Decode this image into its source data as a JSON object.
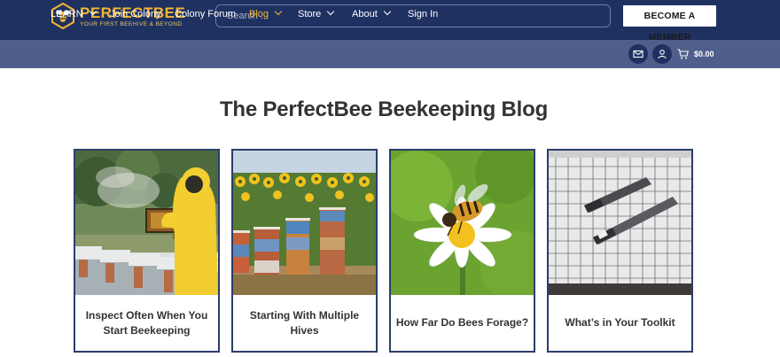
{
  "header": {
    "logo": {
      "name": "PERFECTBEE",
      "tagline": "YOUR FIRST BEEHIVE & BEYOND"
    },
    "search": {
      "placeholder": "Search ..."
    },
    "member_button": "BECOME A MEMBER"
  },
  "nav": {
    "items": [
      {
        "label": "LEARN",
        "dropdown": true,
        "active": false
      },
      {
        "label": "Join Colony",
        "dropdown": false,
        "active": false
      },
      {
        "label": "Colony Forum",
        "dropdown": false,
        "active": false
      },
      {
        "label": "Blog",
        "dropdown": true,
        "active": true
      },
      {
        "label": "Store",
        "dropdown": true,
        "active": false
      },
      {
        "label": "About",
        "dropdown": true,
        "active": false
      },
      {
        "label": "Sign In",
        "dropdown": false,
        "active": false
      }
    ],
    "cart_total": "$0.00"
  },
  "main": {
    "title": "The PerfectBee Beekeeping Blog",
    "cards": [
      {
        "title": "Inspect Often When You Start Beekeeping"
      },
      {
        "title": "Starting With Multiple Hives"
      },
      {
        "title": "How Far Do Bees Forage?"
      },
      {
        "title": "What’s in Your Toolkit"
      }
    ]
  },
  "colors": {
    "header_bg": "#1f3161",
    "nav_bg": "#4f5e8b",
    "accent": "#f2b632",
    "card_border": "#2c3d6b"
  }
}
